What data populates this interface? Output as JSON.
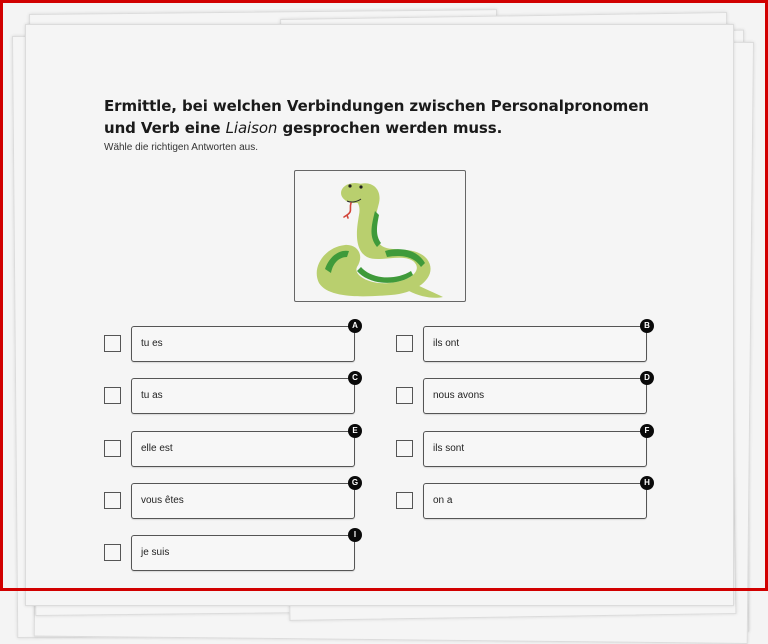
{
  "worksheet": {
    "title_part1": "Ermittle, bei welchen Verbindungen zwischen Personalpronomen und Verb eine ",
    "title_italic": "Liaison",
    "title_part2": " gesprochen werden muss.",
    "instruction": "Wähle die richtigen Antworten aus.",
    "illustration": "snake-illustration",
    "colors": {
      "frame": "#d10000",
      "snake_body": "#b9cf6e",
      "snake_pattern": "#3f9a3a",
      "tongue": "#d2453a",
      "badge": "#0a0a0a"
    }
  },
  "answers": [
    {
      "letter": "A",
      "text": "tu es",
      "checked": false
    },
    {
      "letter": "B",
      "text": "ils ont",
      "checked": false
    },
    {
      "letter": "C",
      "text": "tu as",
      "checked": false
    },
    {
      "letter": "D",
      "text": "nous avons",
      "checked": false
    },
    {
      "letter": "E",
      "text": "elle est",
      "checked": false
    },
    {
      "letter": "F",
      "text": "ils sont",
      "checked": false
    },
    {
      "letter": "G",
      "text": "vous êtes",
      "checked": false
    },
    {
      "letter": "H",
      "text": "on a",
      "checked": false
    },
    {
      "letter": "I",
      "text": "je suis",
      "checked": false
    }
  ]
}
